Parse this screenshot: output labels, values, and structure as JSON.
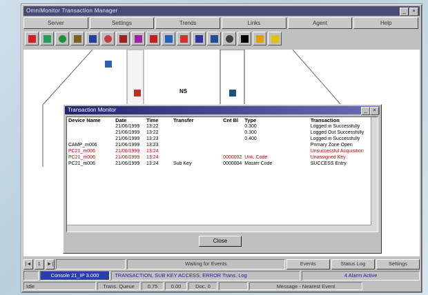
{
  "window": {
    "title": "OmniMonitor Transaction Manager"
  },
  "menu": [
    "Server",
    "Settings",
    "Trends",
    "Links",
    "Agent",
    "Help"
  ],
  "toolbar_icons": [
    "signal-icon",
    "monitor-icon",
    "globe-icon",
    "stack-icon",
    "display-icon",
    "target-icon",
    "tool-icon",
    "book-icon",
    "printer-icon",
    "window-icon",
    "lamp-icon",
    "panel-icon",
    "disk-icon",
    "clock-icon",
    "user-icon",
    "lock-icon",
    "help-icon"
  ],
  "canvas": {
    "node_label": "NS"
  },
  "dialog": {
    "title": "Transaction Monitor",
    "columns": [
      "Device Name",
      "Date",
      "Time",
      "Transfer",
      "Cnt Bl",
      "Type",
      "Transaction"
    ],
    "rows": [
      {
        "c": [
          "",
          "21/06/1999",
          "13:22",
          "",
          "",
          "0.300",
          "Logged in Successfully"
        ],
        "red": false
      },
      {
        "c": [
          "",
          "21/06/1999",
          "13:22",
          "",
          "",
          "0.300",
          "Logged Out Successfully"
        ],
        "red": false
      },
      {
        "c": [
          "",
          "21/06/1999",
          "13:23",
          "",
          "",
          "0.400",
          "Logged in Successfully"
        ],
        "red": false
      },
      {
        "c": [
          "CAMP_m006",
          "21/06/1999",
          "13:23",
          "",
          "",
          "",
          "Primary Zone Open"
        ],
        "red": false
      },
      {
        "c": [
          "PC21_m006",
          "21/06/1999",
          "13:24",
          "",
          "",
          "",
          "Unsuccessful Acquisition"
        ],
        "red": true
      },
      {
        "c": [
          "PC21_m006",
          "21/06/1999",
          "13:24",
          "",
          "0000002",
          "Unk. Code",
          "Unassigned Key"
        ],
        "red": true
      },
      {
        "c": [
          "PC21_m006",
          "21/06/1999",
          "13:24",
          "Sub Key",
          "0000004",
          "Master Code",
          "SUCCESS Entry"
        ],
        "red": false
      }
    ],
    "ok_label": "Close"
  },
  "status": {
    "nav": [
      "|◄",
      "1",
      "►|"
    ],
    "message": "Waiting for Events",
    "buttons": [
      "Events",
      "Status Log",
      "Settings"
    ],
    "blue_field": "Console 21_IP 3.000",
    "info_line": "TRANSACTION, SUB KEY ACCESS, ERROR   Trans. Log",
    "info_right": "4 Alarm Active",
    "bottom": [
      "Idle",
      "Trans. Queue",
      "0.75",
      "0.00",
      "Doc. 0",
      "Message - Nearest Event"
    ]
  }
}
